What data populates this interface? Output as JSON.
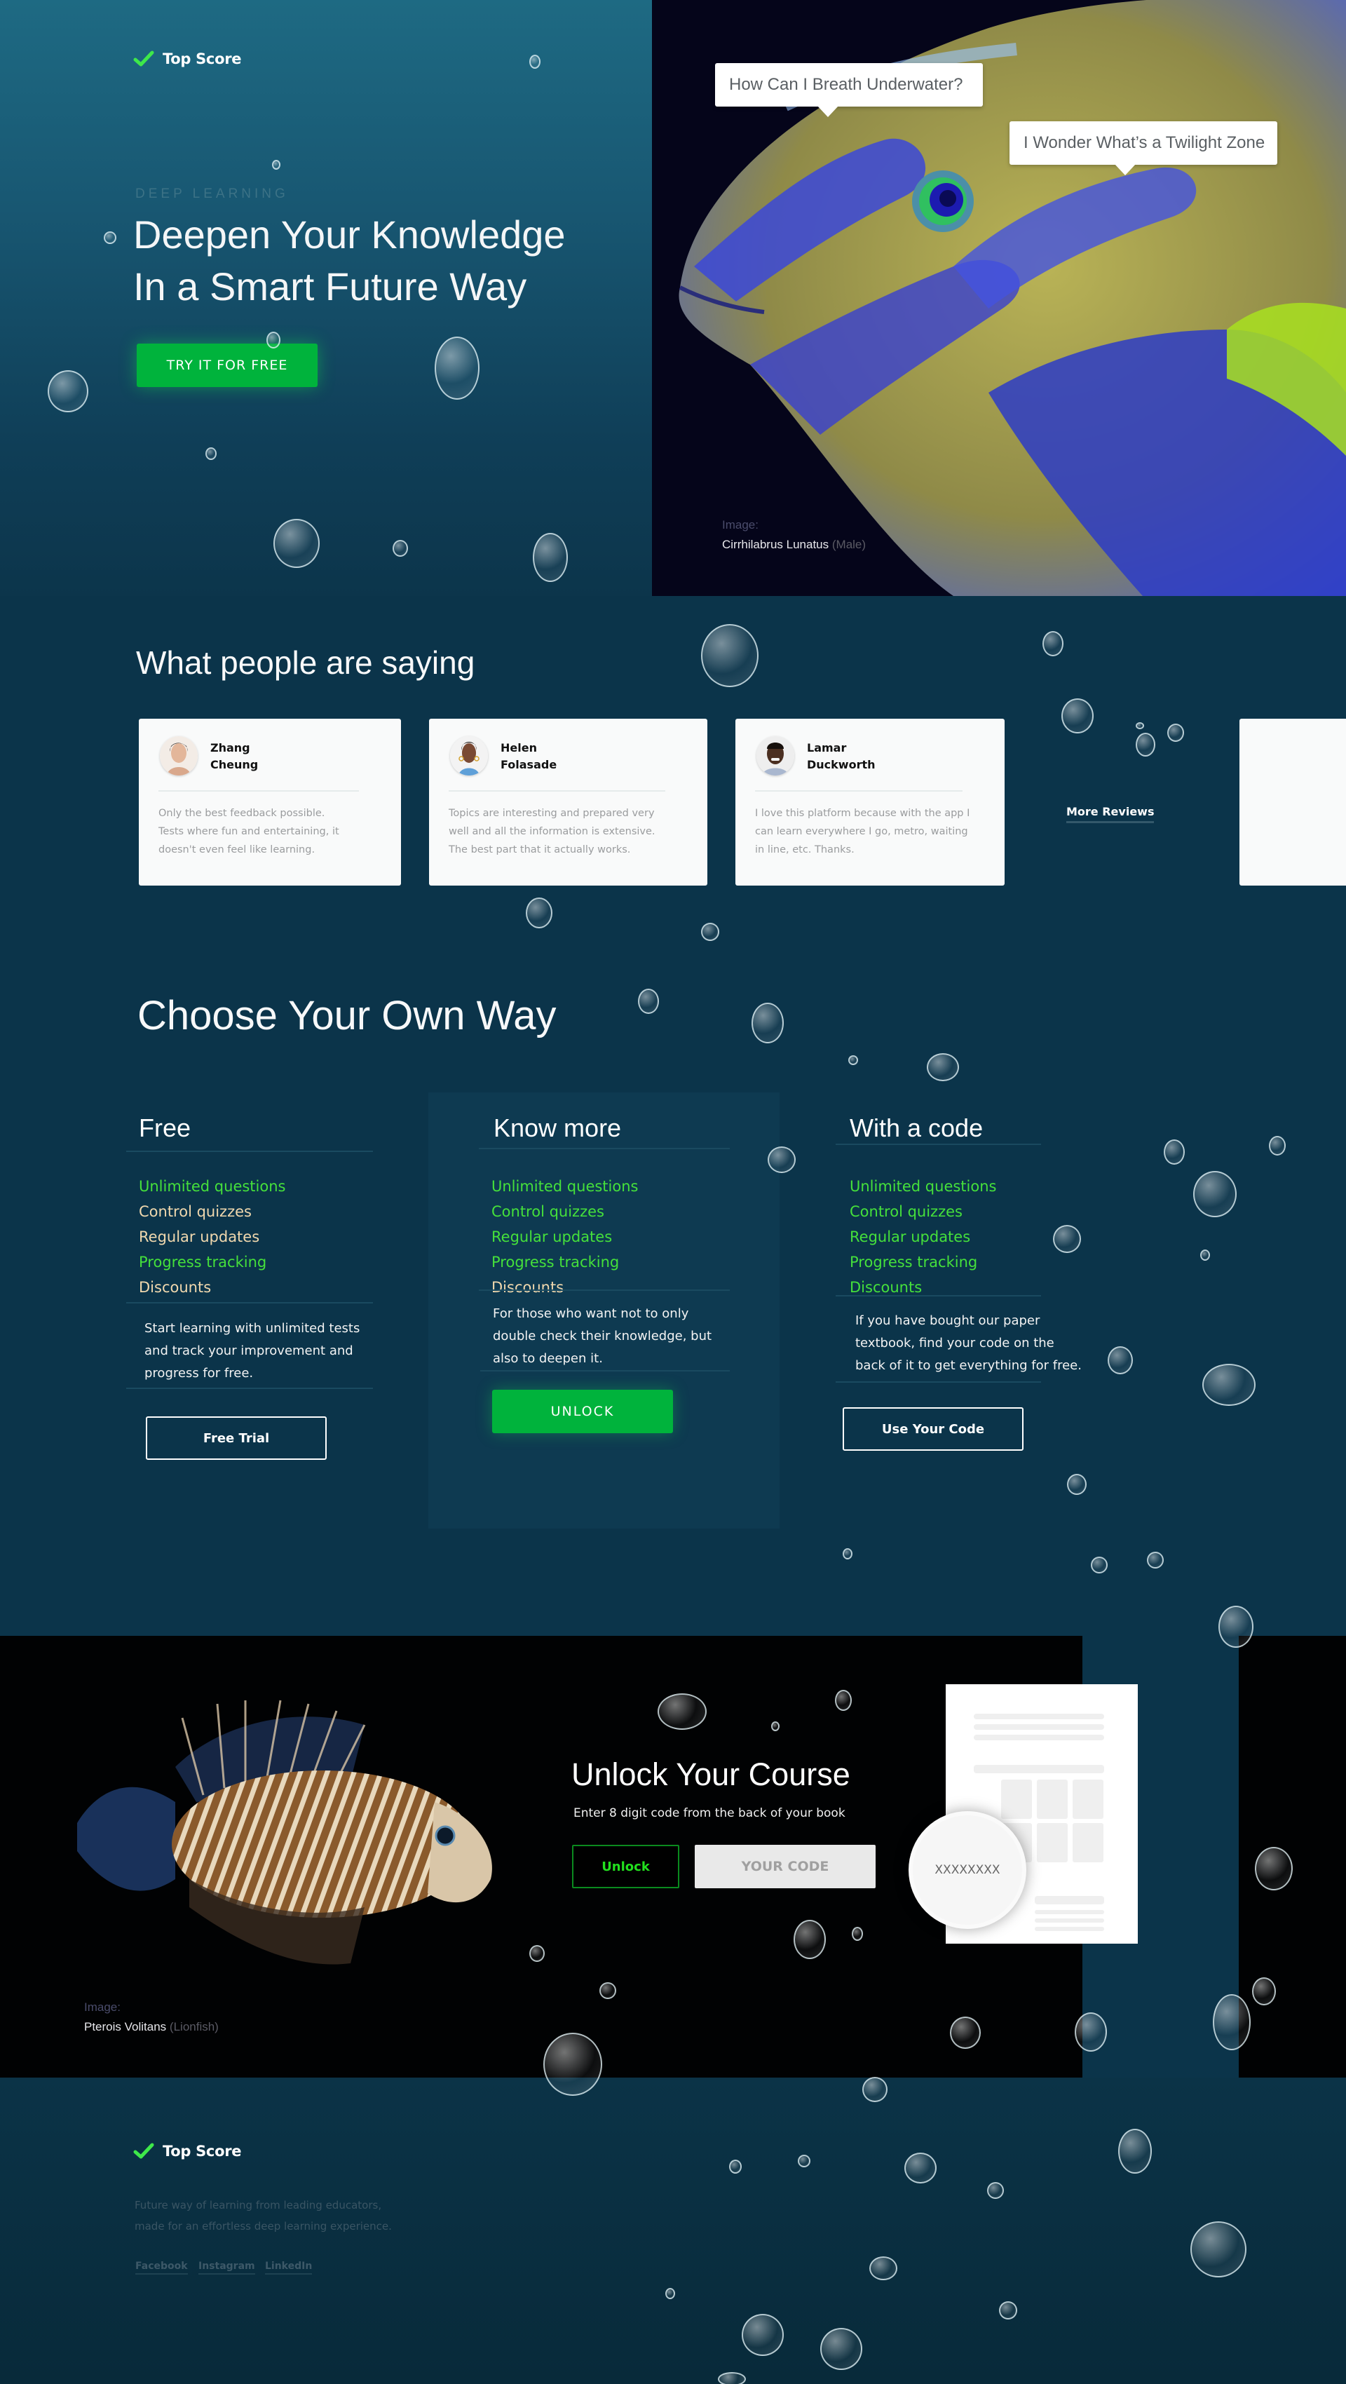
{
  "brand": {
    "name": "Top Score",
    "accent": "#00b33c",
    "check_color": "#3ee84a"
  },
  "hero": {
    "eyebrow": "DEEP LEARNING",
    "title_line1": "Deepen Your Knowledge",
    "title_line2": "In a Smart Future Way",
    "cta": "TRY IT FOR FREE",
    "tooltips": [
      "How Can I Breath Underwater?",
      "I Wonder What’s a Twilight Zone"
    ],
    "image_credit": {
      "label": "Image:",
      "name": "Cirrhilabrus Lunatus",
      "suffix": "(Male)"
    }
  },
  "reviews": {
    "title": "What people are saying",
    "items": [
      {
        "first": "Zhang",
        "last": "Cheung",
        "quote": "Only the best feedback possible. Tests where fun and entertaining, it doesn't even feel like learning."
      },
      {
        "first": "Helen",
        "last": "Folasade",
        "quote": "Topics are interesting and prepared very well and all the information is extensive. The best part that it actually works."
      },
      {
        "first": "Lamar",
        "last": "Duckworth",
        "quote": "I love this platform because with the app I can learn everywhere I go, metro, waiting in line, etc. Thanks."
      }
    ],
    "more_label": "More Reviews"
  },
  "plans": {
    "title": "Choose Your Own Way",
    "items": [
      {
        "name": "Free",
        "features": [
          {
            "label": "Unlimited questions",
            "included": true
          },
          {
            "label": "Control quizzes",
            "included": false
          },
          {
            "label": "Regular updates",
            "included": false
          },
          {
            "label": "Progress tracking",
            "included": true
          },
          {
            "label": "Discounts",
            "included": false
          }
        ],
        "description": "Start learning with unlimited tests and track your improvement and progress for free.",
        "button": "Free Trial"
      },
      {
        "name": "Know more",
        "features": [
          {
            "label": "Unlimited questions",
            "included": true
          },
          {
            "label": "Control quizzes",
            "included": true
          },
          {
            "label": "Regular updates",
            "included": true
          },
          {
            "label": "Progress tracking",
            "included": true
          },
          {
            "label": "Discounts",
            "included": false
          }
        ],
        "description": "For those who want not to only double check their knowledge, but also to deepen it.",
        "button": "UNLOCK"
      },
      {
        "name": "With a code",
        "features": [
          {
            "label": "Unlimited questions",
            "included": true
          },
          {
            "label": "Control quizzes",
            "included": true
          },
          {
            "label": "Regular updates",
            "included": true
          },
          {
            "label": "Progress tracking",
            "included": true
          },
          {
            "label": "Discounts",
            "included": true
          }
        ],
        "description": "If you have bought our paper textbook, find your code on the back of it to get everything for free.",
        "button": "Use Your Code"
      }
    ]
  },
  "unlock": {
    "title": "Unlock Your Course",
    "subtitle": "Enter 8 digit code from the back of your book",
    "button": "Unlock",
    "input_placeholder": "YOUR CODE",
    "code_sample": "XXXXXXXX",
    "image_credit": {
      "label": "Image:",
      "name": "Pterois Volitans",
      "suffix": "(Lionfish)"
    }
  },
  "footer": {
    "brand": "Top Score",
    "desc_line1": "Future way of learning from leading educators,",
    "desc_line2": "made for an effortless deep learning experience.",
    "social": [
      "Facebook",
      "Instagram",
      "LinkedIn"
    ]
  }
}
